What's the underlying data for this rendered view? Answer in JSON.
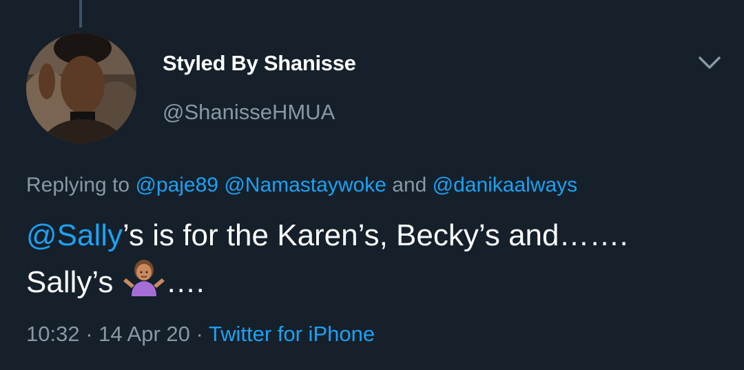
{
  "tweet": {
    "author": {
      "display_name": "Styled By Shanisse",
      "handle": "@ShanisseHMUA",
      "avatar": "profile-photo"
    },
    "more_icon": "chevron-down-icon",
    "reply_context": {
      "prefix": "Replying to",
      "mentions": [
        "@paje89",
        "@Namastaywoke",
        "@danikaalways"
      ],
      "conjunction": "and"
    },
    "body": {
      "mention": "@Sally",
      "line1_rest": "’s is for the Karen’s, Becky’s and…….",
      "line2_start": "Sally’s",
      "emoji": "person-shrugging-emoji",
      "line2_end": "…."
    },
    "meta": {
      "time": "10:32",
      "separator": " · ",
      "date": "14 Apr 20",
      "source": "Twitter for iPhone"
    }
  },
  "colors": {
    "background": "#15202b",
    "text_primary": "#ffffff",
    "text_secondary": "#8899a6",
    "link": "#1da1f2",
    "thread_line": "#3d5466"
  }
}
